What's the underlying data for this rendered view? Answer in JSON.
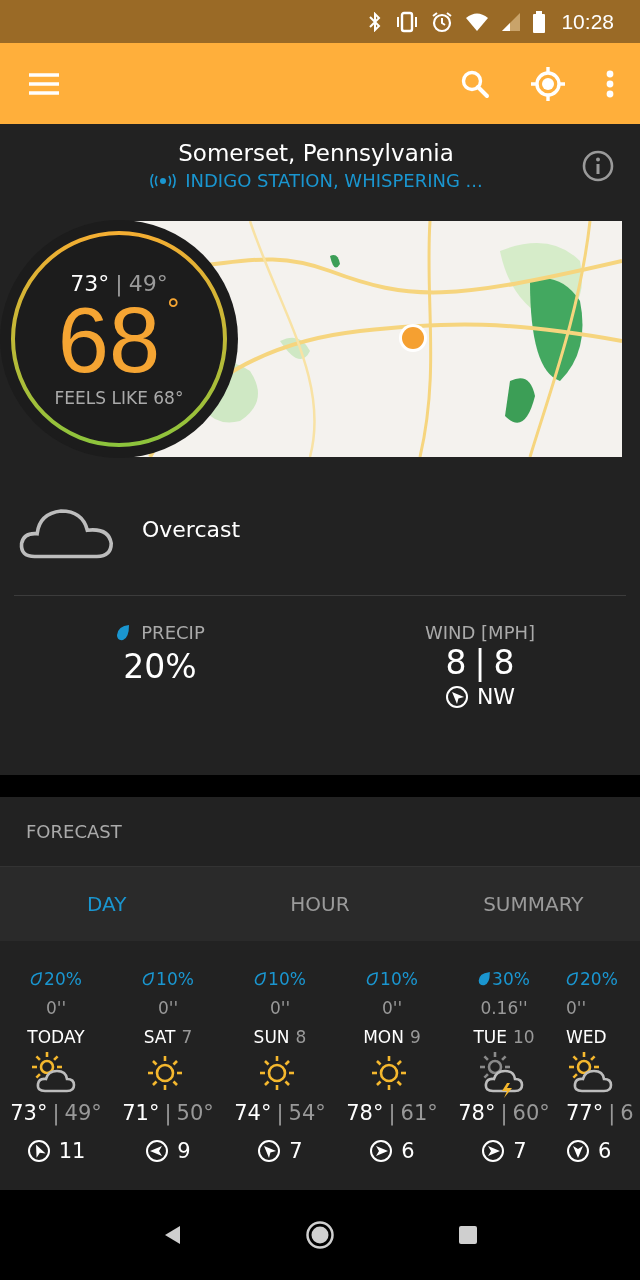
{
  "status_bar": {
    "time": "10:28"
  },
  "location": {
    "title": "Somerset, Pennsylvania",
    "station": "INDIGO STATION, WHISPERING ..."
  },
  "current": {
    "high": "73°",
    "separator": "|",
    "low": "49°",
    "temp": "68",
    "degree": "°",
    "feels_like": "FEELS LIKE 68°",
    "condition": {
      "kind": "cloudy",
      "text": "Overcast"
    }
  },
  "precip": {
    "label": "PRECIP",
    "value": "20%"
  },
  "wind": {
    "label": "WIND [MPH]",
    "speed": "8",
    "separator": "|",
    "gust": "8",
    "direction": {
      "kind": "nw",
      "text": "NW"
    }
  },
  "forecast": {
    "title": "FORECAST",
    "tabs": [
      {
        "label": "DAY",
        "selected": true
      },
      {
        "label": "HOUR",
        "selected": false
      },
      {
        "label": "SUMMARY",
        "selected": false
      }
    ],
    "days": [
      {
        "precip": "20%",
        "drop_filled": false,
        "amount": "0''",
        "day": "TODAY",
        "kind": "partly-cloudy",
        "high": "73°",
        "separator": "|",
        "low": "49°",
        "wind": {
          "kind": "nnw",
          "text": "11"
        }
      },
      {
        "precip": "10%",
        "drop_filled": false,
        "amount": "0''",
        "day": "SAT",
        "date": "7",
        "kind": "sunny",
        "high": "71°",
        "separator": "|",
        "low": "50°",
        "wind": {
          "kind": "w",
          "text": "9"
        }
      },
      {
        "precip": "10%",
        "drop_filled": false,
        "amount": "0''",
        "day": "SUN",
        "date": "8",
        "kind": "sunny",
        "high": "74°",
        "separator": "|",
        "low": "54°",
        "wind": {
          "kind": "nw",
          "text": "7"
        }
      },
      {
        "precip": "10%",
        "drop_filled": false,
        "amount": "0''",
        "day": "MON",
        "date": "9",
        "kind": "sunny",
        "high": "78°",
        "separator": "|",
        "low": "61°",
        "wind": {
          "kind": "e",
          "text": "6"
        }
      },
      {
        "precip": "30%",
        "drop_filled": true,
        "amount": "0.16''",
        "day": "TUE",
        "date": "10",
        "kind": "thunderstorm",
        "high": "78°",
        "separator": "|",
        "low": "60°",
        "wind": {
          "kind": "e",
          "text": "7"
        }
      },
      {
        "precip": "20%",
        "drop_filled": false,
        "amount": "0''",
        "day": "WED",
        "kind": "partly-cloudy",
        "high": "77°",
        "separator": "|",
        "low": "6",
        "wind": {
          "kind": "s",
          "text": "6"
        }
      }
    ]
  }
}
